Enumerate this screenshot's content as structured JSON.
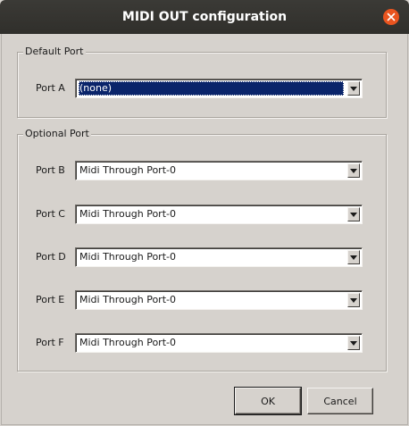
{
  "window": {
    "title": "MIDI OUT configuration",
    "close_icon": "close-icon"
  },
  "default_group": {
    "legend": "Default Port",
    "rows": [
      {
        "label": "Port A",
        "value": "(none)",
        "selected": true
      }
    ]
  },
  "optional_group": {
    "legend": "Optional Port",
    "rows": [
      {
        "label": "Port B",
        "value": "Midi Through Port-0"
      },
      {
        "label": "Port C",
        "value": "Midi Through Port-0"
      },
      {
        "label": "Port D",
        "value": "Midi Through Port-0"
      },
      {
        "label": "Port E",
        "value": "Midi Through Port-0"
      },
      {
        "label": "Port F",
        "value": "Midi Through Port-0"
      }
    ]
  },
  "buttons": {
    "ok": "OK",
    "cancel": "Cancel"
  },
  "colors": {
    "titlebar": "#302f2b",
    "close_button": "#e9541f",
    "selection": "#0a246a",
    "dialog_background": "#d6d2cd"
  }
}
